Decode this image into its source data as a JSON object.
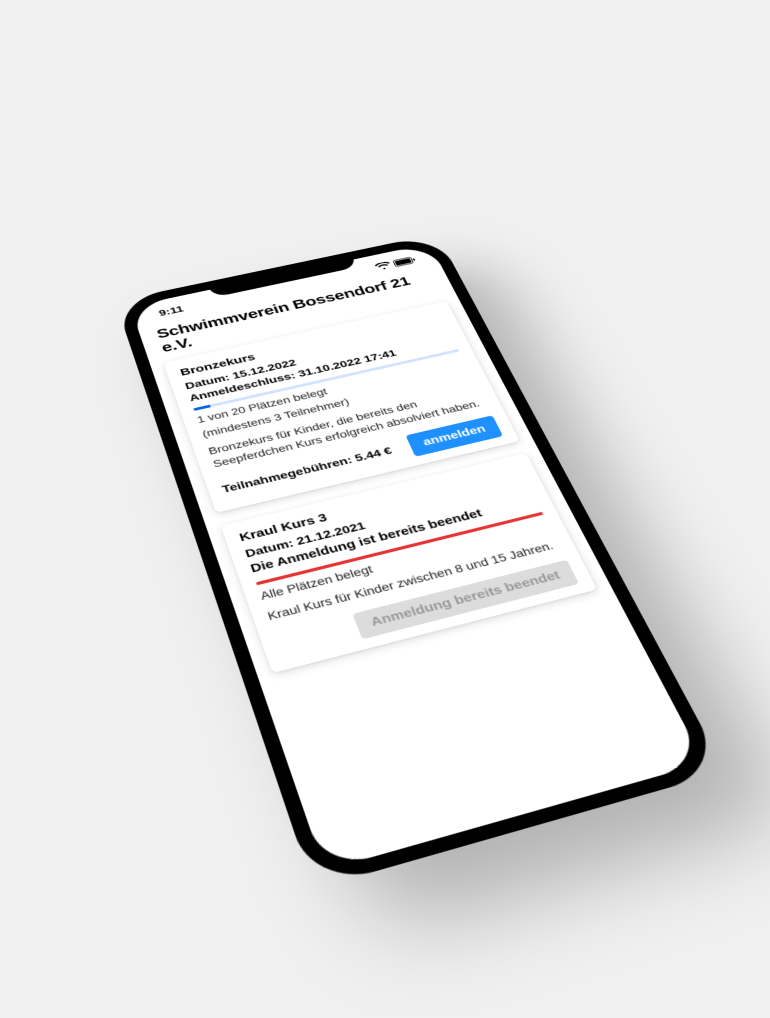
{
  "statusbar": {
    "time": "9:11"
  },
  "header": {
    "title": "Schwimmverein Bossendorf 21 e.V."
  },
  "courses": {
    "c1": {
      "title": "Bronzekurs",
      "date_line": "Datum: 15.12.2022",
      "deadline_line": "Anmeldeschluss: 31.10.2022 17:41",
      "capacity_line": "1 von 20 Plätzen belegt",
      "min_line": "(mindestens 3 Teilnehmer)",
      "description": "Bronzekurs für Kinder, die bereits den Seepferdchen Kurs erfolgreich absolviert haben.",
      "fee_label": "Teilnahmegebühren: 5.44 €",
      "button_label": "anmelden",
      "button_enabled": true
    },
    "c2": {
      "title": "Kraul Kurs 3",
      "date_line": "Datum: 21.12.2021",
      "closed_line": "Die Anmeldung ist bereits beendet",
      "capacity_line": "Alle Plätzen belegt",
      "description": "Kraul Kurs für Kinder zwischen 8 und 15 Jahren.",
      "button_label": "Anmeldung bereits beendet",
      "button_enabled": false
    }
  }
}
